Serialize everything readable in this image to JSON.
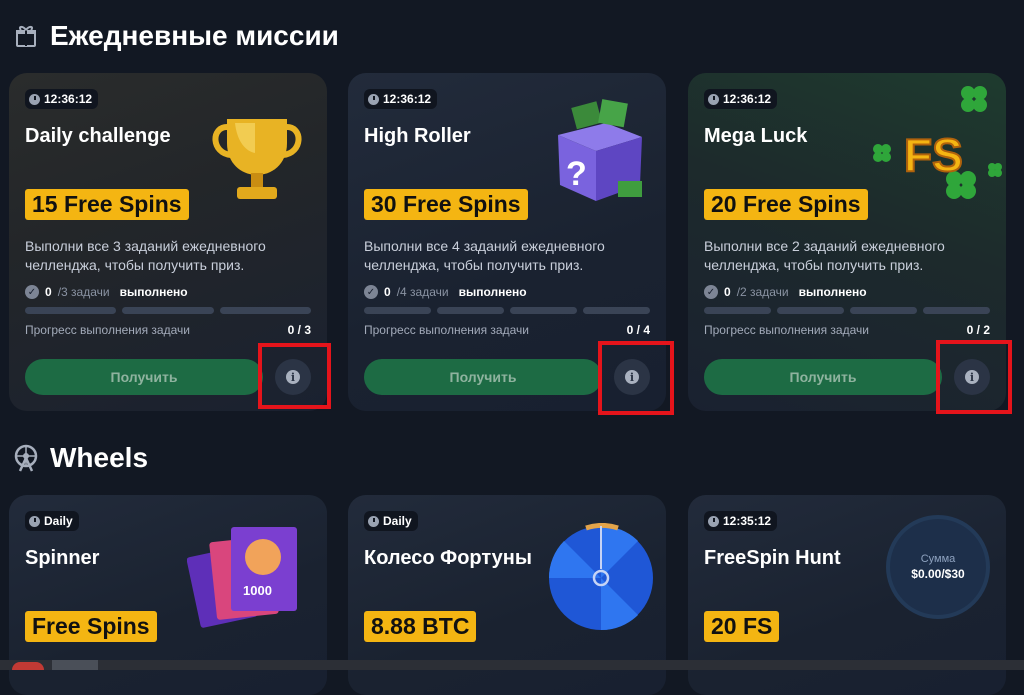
{
  "sections": {
    "missions_title": "Ежедневные миссии",
    "wheels_title": "Wheels"
  },
  "missions": [
    {
      "timer": "12:36:12",
      "title": "Daily challenge",
      "prize": "15 Free Spins",
      "description": "Выполни все 3 заданий ежедневного челленджа, чтобы получить приз.",
      "tasks_count": "0",
      "tasks_total": "/3 задачи",
      "tasks_done": "выполнено",
      "progress_label": "Прогресс выполнения задачи",
      "progress_value": "0 / 3",
      "progress_fraction": 0,
      "segments": 3,
      "button": "Получить",
      "image": "trophy-image"
    },
    {
      "timer": "12:36:12",
      "title": "High Roller",
      "prize": "30 Free Spins",
      "description": "Выполни все 4 заданий ежедневного челленджа, чтобы получить приз.",
      "tasks_count": "0",
      "tasks_total": "/4 задачи",
      "tasks_done": "выполнено",
      "progress_label": "Прогресс выполнения задачи",
      "progress_value": "0 / 4",
      "progress_fraction": 0,
      "segments": 4,
      "button": "Получить",
      "image": "mystery-box-image"
    },
    {
      "timer": "12:36:12",
      "title": "Mega Luck",
      "prize": "20 Free Spins",
      "description": "Выполни все 2 заданий ежедневного челленджа, чтобы получить приз.",
      "tasks_count": "0",
      "tasks_total": "/2 задачи",
      "tasks_done": "выполнено",
      "progress_label": "Прогресс выполнения задачи",
      "progress_value": "0 / 2",
      "progress_fraction": 0,
      "segments": 4,
      "button": "Получить",
      "image": "fs-clover-image"
    }
  ],
  "wheels": [
    {
      "timer": "Daily",
      "title": "Spinner",
      "prize": "Free Spins",
      "image": "slot-cards-image"
    },
    {
      "timer": "Daily",
      "title": "Колесо Фортуны",
      "prize": "8.88 BTC",
      "image": "fortune-wheel-image"
    },
    {
      "timer": "12:35:12",
      "title": "FreeSpin Hunt",
      "prize": "20 FS",
      "sum_label": "Сумма",
      "sum_value": "$0.00/$30",
      "image": "sum-circle"
    }
  ],
  "images": {
    "slot_card_text": "1000",
    "fs_text": "FS"
  },
  "colors": {
    "background": "#121823",
    "prize_badge": "#f4b512",
    "get_button": "#1d6b44",
    "highlight": "#e5141b"
  }
}
